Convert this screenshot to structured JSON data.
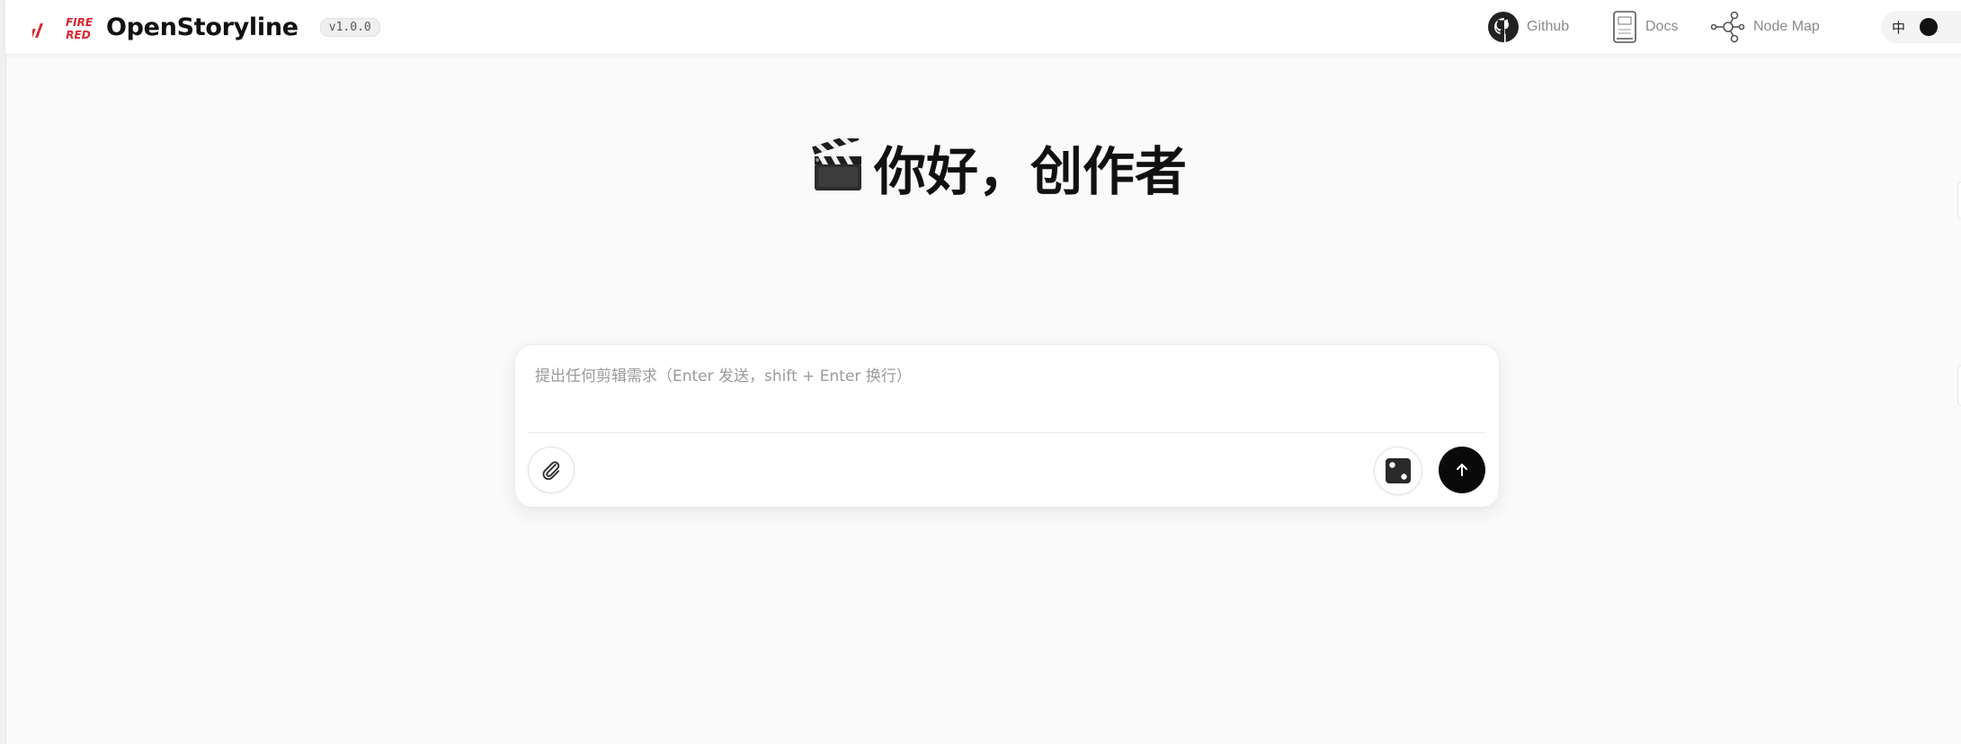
{
  "header": {
    "brand_name": "OpenStoryline",
    "brand_logo_text": [
      "FIRE",
      "RED"
    ],
    "version": "v1.0.0",
    "nav": [
      {
        "label": "Github",
        "icon": "github-icon"
      },
      {
        "label": "Docs",
        "icon": "docs-icon"
      },
      {
        "label": "Node Map",
        "icon": "node-map-icon"
      }
    ],
    "language_toggle": {
      "label": "中"
    }
  },
  "main": {
    "greeting": "你好，创作者",
    "greeting_icon": "clapper-board-icon"
  },
  "composer": {
    "placeholder": "提出任何剪辑需求（Enter 发送，shift + Enter 换行）",
    "value": "",
    "attach_icon": "paperclip-icon",
    "dice_icon": "dice-icon",
    "send_icon": "arrow-up-icon"
  },
  "colors": {
    "brand_red": "#d8262f",
    "send_button": "#0a0a0a",
    "nav_text": "#8a8a8a",
    "background": "#fafafa"
  }
}
